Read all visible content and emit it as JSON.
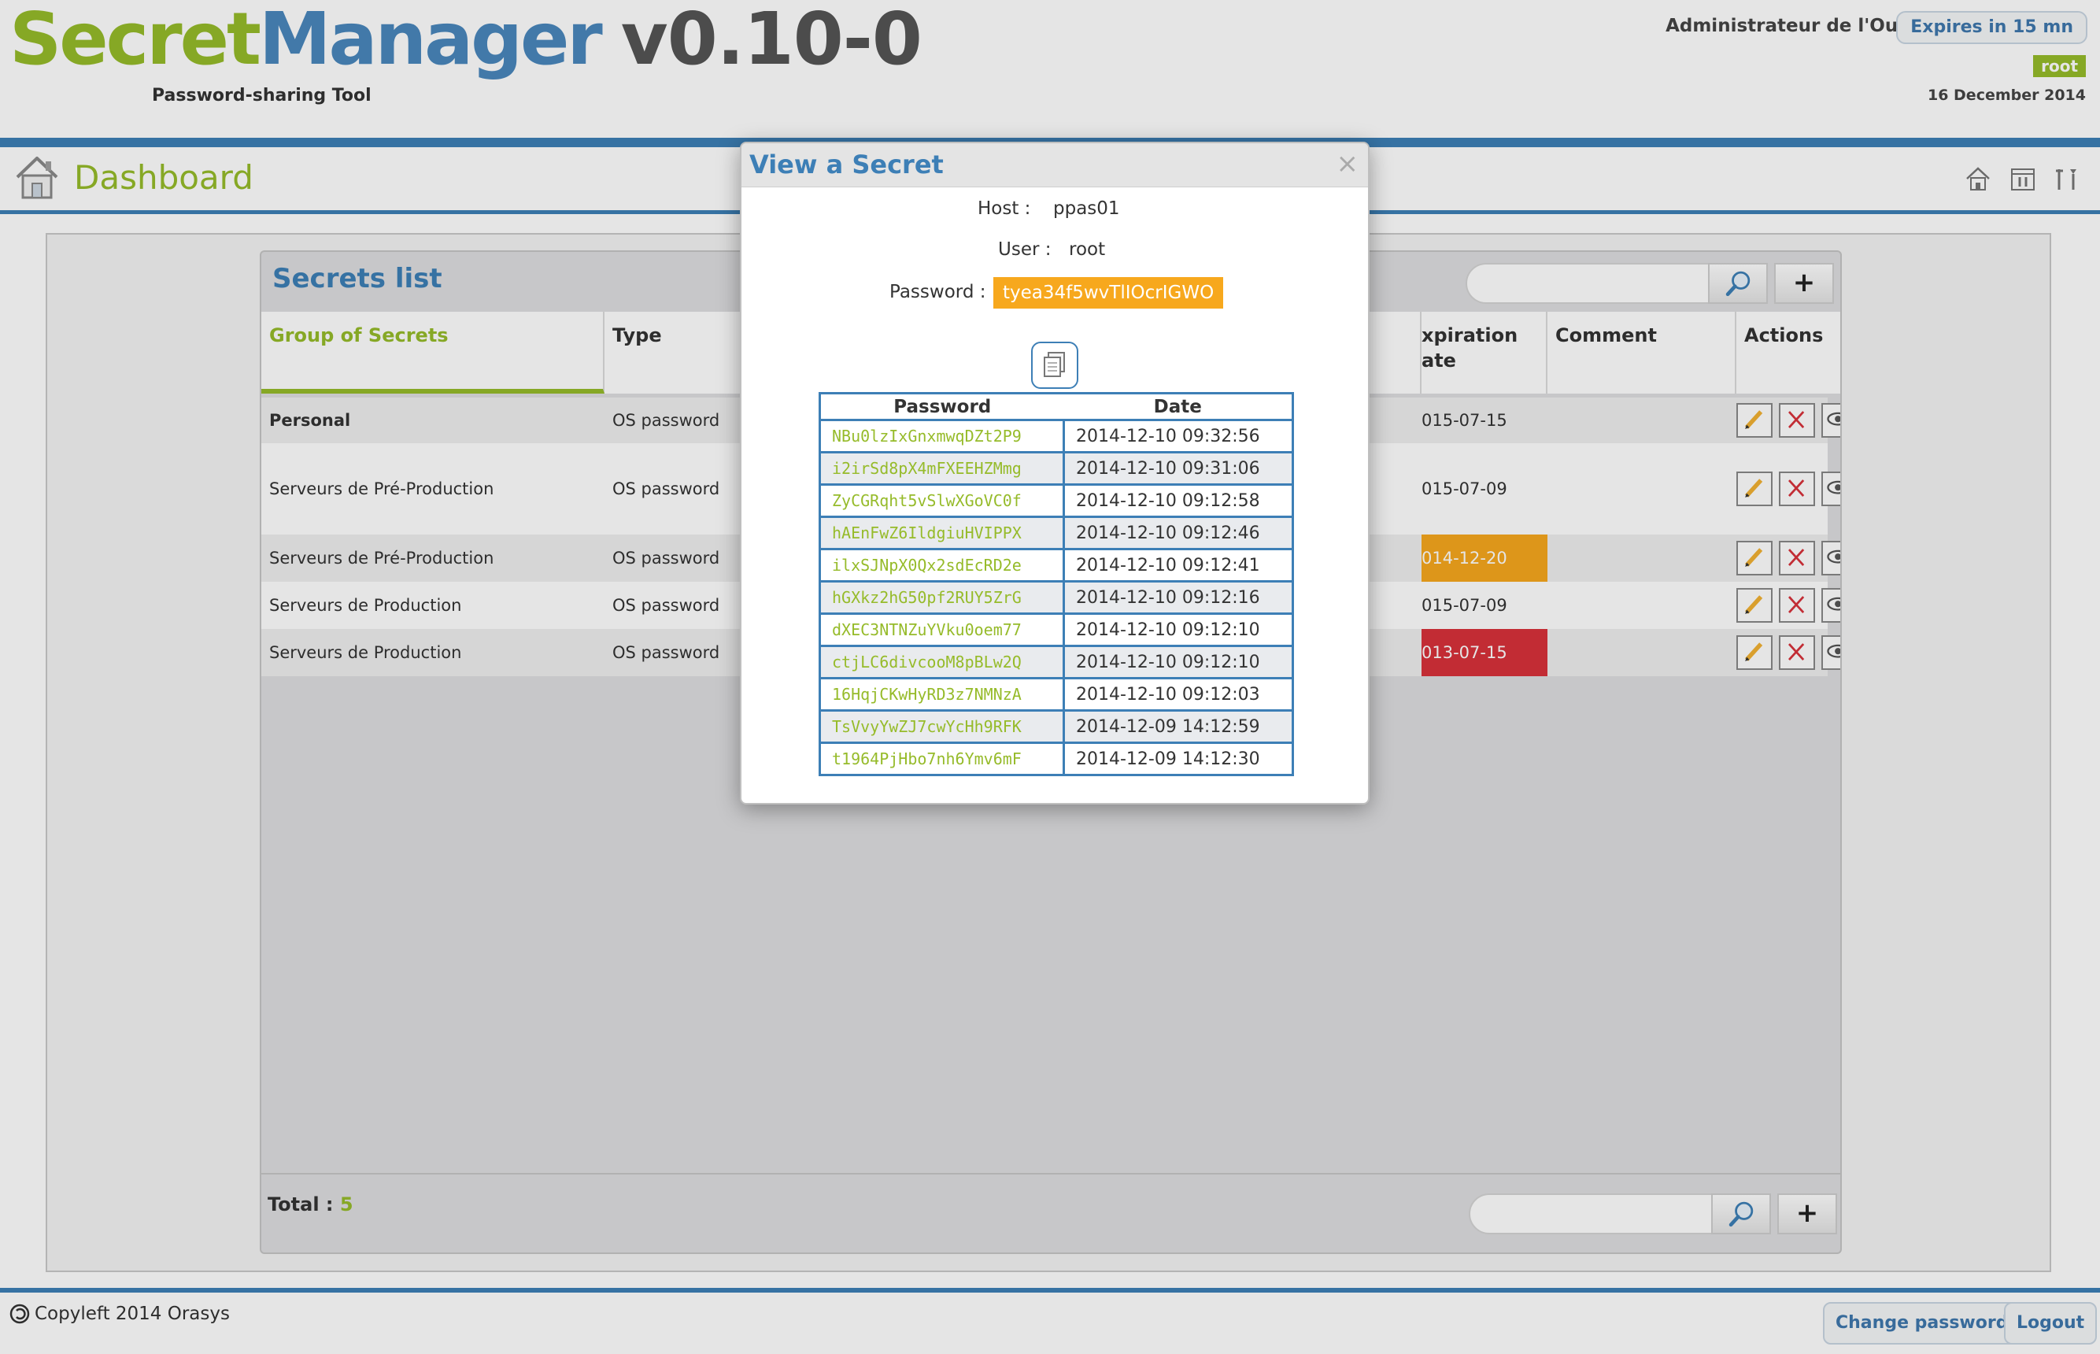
{
  "header": {
    "logo_secret": "Secret",
    "logo_manager": "Manager",
    "logo_version": "v0.10-0",
    "tagline": "Password-sharing Tool",
    "user_name": "Administrateur de l'Outil",
    "expires": "Expires in 15 mn",
    "user_badge": "root",
    "date": "16 December 2014"
  },
  "nav": {
    "title": "Dashboard",
    "icons": [
      "home-icon",
      "tools-icon",
      "settings-icon"
    ]
  },
  "secrets_list": {
    "title": "Secrets list",
    "search_placeholder": "",
    "add_label": "+",
    "columns": {
      "group": "Group of Secrets",
      "type": "Type",
      "expiration_line1": "xpiration",
      "expiration_line2": "ate",
      "comment": "Comment",
      "actions": "Actions"
    },
    "rows": [
      {
        "group": "Personal",
        "type": "OS password",
        "expiration": "015-07-15",
        "comment": "",
        "status": "normal"
      },
      {
        "group": "Serveurs de Pré-Production",
        "type": "OS password",
        "expiration": "015-07-09",
        "comment": "",
        "status": "normal"
      },
      {
        "group": "Serveurs de Pré-Production",
        "type": "OS password",
        "expiration": "014-12-20",
        "comment": "",
        "status": "warning"
      },
      {
        "group": "Serveurs de Production",
        "type": "OS password",
        "expiration": "015-07-09",
        "comment": "",
        "status": "normal"
      },
      {
        "group": "Serveurs de Production",
        "type": "OS password",
        "expiration": "013-07-15",
        "comment": "",
        "status": "expired"
      }
    ],
    "total_label": "Total :",
    "total_value": "5"
  },
  "modal": {
    "title": "View a Secret",
    "close": "×",
    "host_label": "Host :",
    "host_value": "ppas01",
    "user_label": "User :",
    "user_value": "root",
    "password_label": "Password :",
    "password_value": "tyea34f5wvTlIOcrIGWO",
    "history_headers": {
      "password": "Password",
      "date": "Date"
    },
    "history": [
      {
        "password": "NBu0lzIxGnxmwqDZt2P9",
        "date": "2014-12-10 09:32:56"
      },
      {
        "password": "i2irSd8pX4mFXEEHZMmg",
        "date": "2014-12-10 09:31:06"
      },
      {
        "password": "ZyCGRqht5vSlwXGoVC0f",
        "date": "2014-12-10 09:12:58"
      },
      {
        "password": "hAEnFwZ6IldgiuHVIPPX",
        "date": "2014-12-10 09:12:46"
      },
      {
        "password": "ilxSJNpX0Qx2sdEcRD2e",
        "date": "2014-12-10 09:12:41"
      },
      {
        "password": "hGXkz2hG50pf2RUY5ZrG",
        "date": "2014-12-10 09:12:16"
      },
      {
        "password": "dXEC3NTNZuYVku0oem77",
        "date": "2014-12-10 09:12:10"
      },
      {
        "password": "ctjLC6divcooM8pBLw2Q",
        "date": "2014-12-10 09:12:10"
      },
      {
        "password": "16HqjCKwHyRD3z7NMNzA",
        "date": "2014-12-10 09:12:03"
      },
      {
        "password": "TsVvyYwZJ7cwYcHh9RFK",
        "date": "2014-12-09 14:12:59"
      },
      {
        "password": "t1964PjHbo7nh6Ymv6mF",
        "date": "2014-12-09 14:12:30"
      }
    ]
  },
  "footer": {
    "copyleft": "Copyleft 2014 Orasys",
    "change_password": "Change password",
    "logout": "Logout"
  },
  "colors": {
    "brand_green": "#96bb2a",
    "brand_blue": "#3d7fb6",
    "warning": "#f7a81d",
    "expired": "#d8323a"
  }
}
